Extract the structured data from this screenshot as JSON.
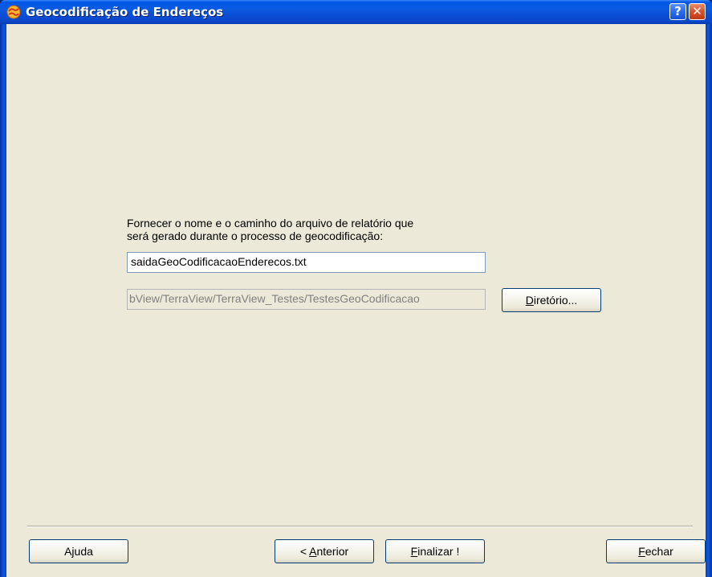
{
  "window": {
    "title": "Geocodificação de Endereços",
    "help_glyph": "?",
    "close_glyph": "✕"
  },
  "prompt": {
    "line1": "Fornecer o nome e o caminho do arquivo de relatório que",
    "line2": "será gerado durante o processo de geocodificação:"
  },
  "filename_input": {
    "value": "saidaGeoCodificacaoEnderecos.txt"
  },
  "directory_input": {
    "value": "bView/TerraView/TerraView_Testes/TestesGeoCodificacao"
  },
  "buttons": {
    "directory": {
      "mnemonic": "D",
      "rest": "iretório..."
    },
    "help": {
      "pre": "A",
      "mnemonic": "j",
      "rest": "uda"
    },
    "previous": {
      "pre": "< ",
      "mnemonic": "A",
      "rest": "nterior"
    },
    "finish": {
      "mnemonic": "F",
      "rest": "inalizar !"
    },
    "close": {
      "mnemonic": "F",
      "rest": "echar"
    }
  },
  "colors": {
    "titlebar": "#0a5ae0",
    "dialog_bg": "#ece9d8",
    "button_border": "#003c74"
  },
  "icons": {
    "app": "terraview-globe-icon",
    "help": "help-question-icon",
    "close": "close-x-icon"
  }
}
